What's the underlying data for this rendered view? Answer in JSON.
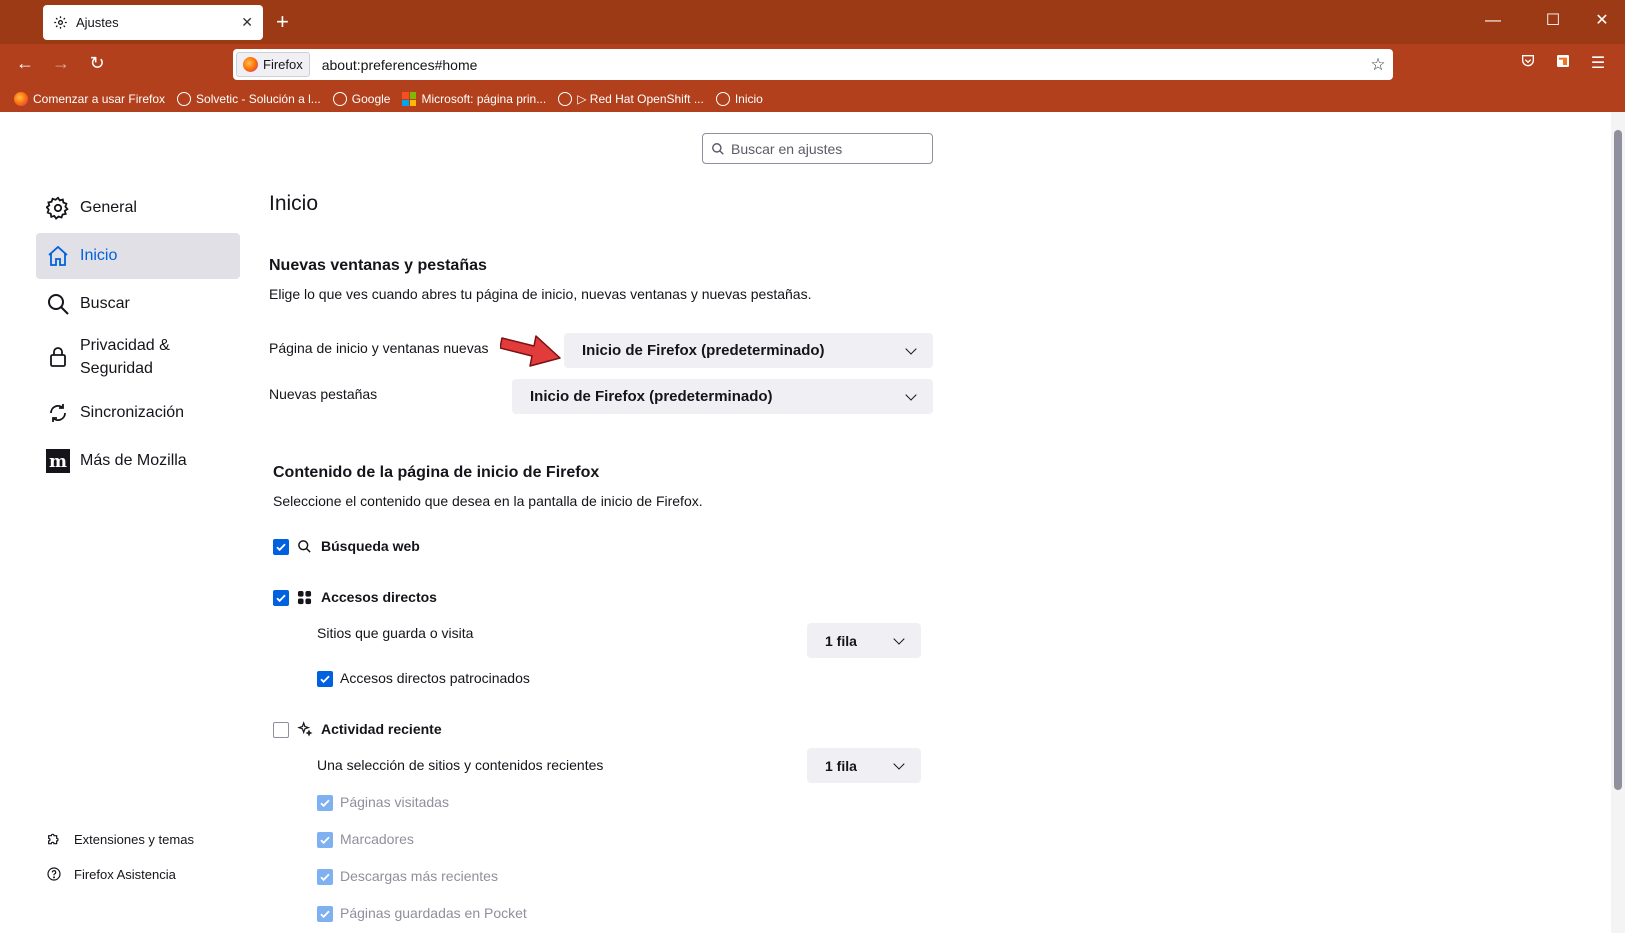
{
  "tab": {
    "title": "Ajustes",
    "close": "✕"
  },
  "window_controls": {
    "minimize": "—",
    "maximize": "☐",
    "close": "✕"
  },
  "toolbar": {
    "new_tab": "+",
    "back": "←",
    "forward": "→",
    "reload": "↻"
  },
  "url": {
    "identity_label": "Firefox",
    "address": "about:preferences#home"
  },
  "bookmarks": [
    {
      "label": "Comenzar a usar Firefox",
      "icon": "firefox-icon"
    },
    {
      "label": "Solvetic - Solución a l...",
      "icon": "globe-icon"
    },
    {
      "label": "Google",
      "icon": "globe-icon"
    },
    {
      "label": "Microsoft: página prin...",
      "icon": "microsoft-icon"
    },
    {
      "label": "▷ Red Hat OpenShift ...",
      "icon": "globe-icon"
    },
    {
      "label": "Inicio",
      "icon": "globe-icon"
    }
  ],
  "search": {
    "placeholder": "Buscar en ajustes"
  },
  "sidebar": {
    "items": [
      {
        "label": "General",
        "icon": "gear-icon"
      },
      {
        "label": "Inicio",
        "icon": "home-icon",
        "active": true
      },
      {
        "label": "Buscar",
        "icon": "search-icon"
      },
      {
        "label": "Privacidad &\nSeguridad",
        "icon": "lock-icon"
      },
      {
        "label": "Sincronización",
        "icon": "sync-icon"
      },
      {
        "label": "Más de Mozilla",
        "icon": "mozilla-icon"
      }
    ],
    "footer": [
      {
        "label": "Extensiones y temas",
        "icon": "puzzle-icon"
      },
      {
        "label": "Firefox Asistencia",
        "icon": "help-icon"
      }
    ]
  },
  "main": {
    "title": "Inicio",
    "windows_section": {
      "heading": "Nuevas ventanas y pestañas",
      "description": "Elige lo que ves cuando abres tu página de inicio, nuevas ventanas y nuevas pestañas.",
      "homepage_label": "Página de inicio y ventanas nuevas",
      "homepage_value": "Inicio de Firefox (predeterminado)",
      "newtabs_label": "Nuevas pestañas",
      "newtabs_value": "Inicio de Firefox (predeterminado)"
    },
    "content_section": {
      "heading": "Contenido de la página de inicio de Firefox",
      "description": "Seleccione el contenido que desea en la pantalla de inicio de Firefox.",
      "web_search": {
        "label": "Búsqueda web",
        "checked": true
      },
      "shortcuts": {
        "label": "Accesos directos",
        "checked": true
      },
      "shortcuts_rows_label": "Sitios que guarda o visita",
      "shortcuts_rows_value": "1 fila",
      "sponsored": {
        "label": "Accesos directos patrocinados",
        "checked": true
      },
      "recent": {
        "label": "Actividad reciente",
        "checked": false
      },
      "recent_rows_label": "Una selección de sitios y contenidos recientes",
      "recent_rows_value": "1 fila",
      "recent_options": [
        {
          "label": "Páginas visitadas",
          "checked": true
        },
        {
          "label": "Marcadores",
          "checked": true
        },
        {
          "label": "Descargas más recientes",
          "checked": true
        },
        {
          "label": "Páginas guardadas en Pocket",
          "checked": true
        }
      ]
    }
  },
  "colors": {
    "chrome": "#b2401c",
    "tabbar": "#9c3a15",
    "accent": "#0061e0",
    "arrow": "#e23b3b"
  }
}
